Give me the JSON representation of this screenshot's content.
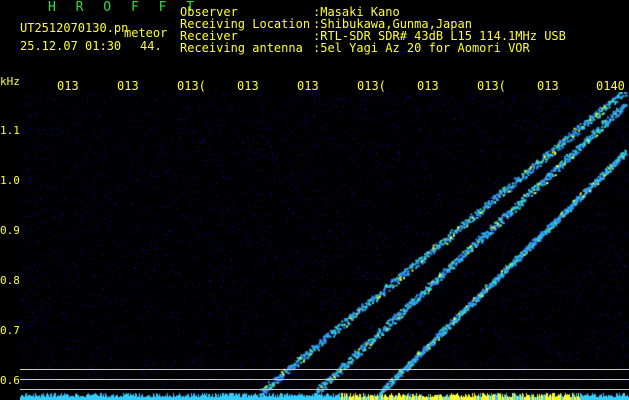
{
  "header": {
    "app_title": "H R O F F T",
    "filename": "UT2512070130.pn",
    "mode": "meteor",
    "datetime": "25.12.07 01:30",
    "value": "44.",
    "fields": [
      {
        "label": "Observer",
        "value": ":Masaki Kano"
      },
      {
        "label": "Receiving Location",
        "value": ":Shibukawa,Gunma,Japan"
      },
      {
        "label": "Receiver",
        "value": ":RTL-SDR SDR# 43dB L15 114.1MHz USB"
      },
      {
        "label": "Receiving antenna",
        "value": ":5el Yagi Az 20 for Aomori VOR"
      }
    ]
  },
  "axis": {
    "unit": "kHz",
    "y_ticks": [
      "1.1",
      "1.0",
      "0.9",
      "0.8",
      "0.7",
      "0.6"
    ],
    "time_ticks": [
      "013",
      "013",
      "013(",
      "013",
      "013",
      "013(",
      "013",
      "013(",
      "013",
      "0140"
    ]
  },
  "colors": {
    "background": "#000000",
    "label_text": "#ffff33",
    "title_text": "#33dd33",
    "noise": "#1a1a7a",
    "trace": "#3399ff",
    "trace_hot": "#ffff33",
    "baseline": "#33ccff",
    "guide_line": "#c8c8c8"
  }
}
